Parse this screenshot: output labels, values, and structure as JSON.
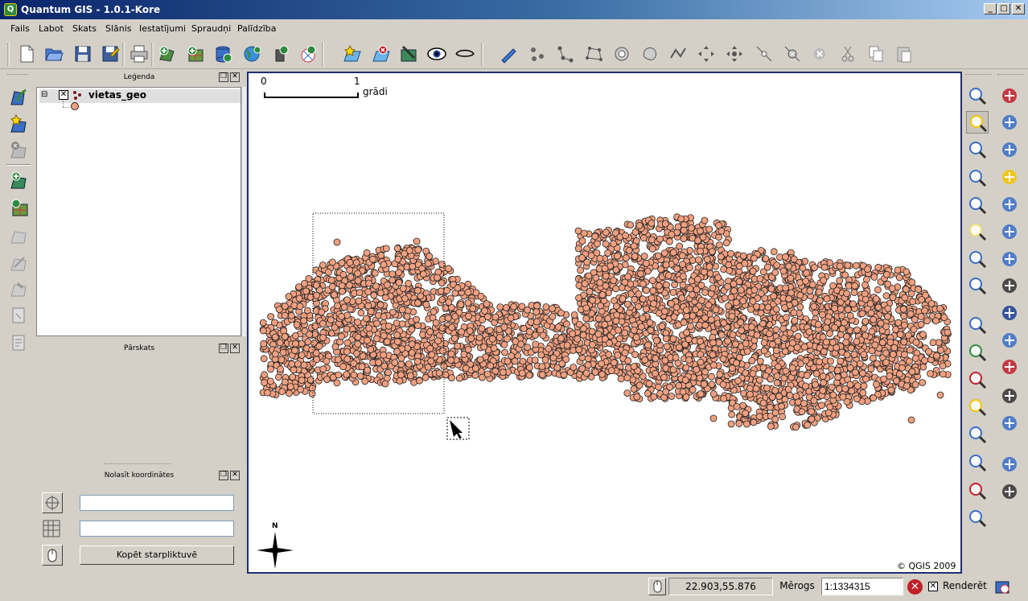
{
  "window": {
    "title": "Quantum GIS - 1.0.1-Kore",
    "logo_letter": "Q",
    "minimize": "_",
    "maximize": "□",
    "close": "✕"
  },
  "menu": [
    "Fails",
    "Labot",
    "Skats",
    "Slānis",
    "Iestatījumi",
    "Spraudņi",
    "Palīdzība"
  ],
  "panels": {
    "legend": {
      "title": "Leģenda",
      "layer_name": "vietas_geo",
      "expander": "⊟"
    },
    "overview": {
      "title": "Pārskats"
    },
    "coords": {
      "title": "Nolasīt koordinātes",
      "input1_value": "",
      "input2_value": "",
      "copy_button": "Kopēt starpliktuvē"
    }
  },
  "map": {
    "scalebar_start": "0",
    "scalebar_end": "1",
    "scalebar_unit": "grādi",
    "north_label": "N",
    "copyright": "© QGIS 2009",
    "point_color": "#f0a080",
    "point_stroke": "#222222"
  },
  "status": {
    "coordinates": "22.903,55.876",
    "scale_label": "Mērogs",
    "scale_value": "1:1334315",
    "render_label": "Renderēt",
    "render_checked": true
  },
  "icons": {
    "toolbar": [
      "new-project-icon",
      "open-project-icon",
      "save-project-icon",
      "save-as-icon",
      "print-icon",
      "add-vector-icon",
      "add-raster-icon",
      "add-postgis-icon",
      "add-wms-icon",
      "add-wfs-icon",
      "add-gps-icon",
      "new-layer-icon",
      "remove-layer-icon",
      "toggle-editing-icon",
      "show-all-icon",
      "hide-all-icon",
      "digitize-icon",
      "capture-point-icon",
      "capture-line-icon",
      "capture-polygon-icon",
      "add-ring-icon",
      "add-island-icon",
      "reshape-icon",
      "move-feature-icon",
      "move-vertex-icon",
      "add-vertex-icon",
      "delete-vertex-icon",
      "delete-selected-icon",
      "cut-icon",
      "copy-icon",
      "paste-icon"
    ],
    "left": [
      "add-vector-layer-icon",
      "new-shapefile-icon",
      "remove-layer-icon",
      "add-wms-layer-icon",
      "add-raster-layer-icon",
      "layer-disabled-icon",
      "layer-edit-disabled-icon",
      "layer-tool-disabled-icon",
      "layer-props-icon",
      "layer-query-icon"
    ],
    "right1": [
      "identify-icon",
      "select-icon",
      "attribute-table-icon",
      "measure-line-icon",
      "measure-area-icon",
      "map-tips-icon",
      "zoom-home-icon",
      "zoom-bookmark-icon",
      "pan-icon",
      "zoom-in-icon",
      "zoom-out-icon",
      "zoom-full-icon",
      "zoom-layer-icon",
      "zoom-selection-icon",
      "zoom-last-icon",
      "refresh-icon"
    ],
    "right2": [
      "north-arrow-icon",
      "copyright-icon",
      "save-to-file-icon",
      "decimal-to-dms-icon",
      "georeferencer-icon",
      "grass-icon",
      "globe-icon",
      "terrain-icon",
      "navigation-icon",
      "gdal-icon",
      "pdf-icon",
      "scale-bar-icon",
      "elephant-icon",
      "help-book-icon",
      "whats-this-icon"
    ]
  }
}
